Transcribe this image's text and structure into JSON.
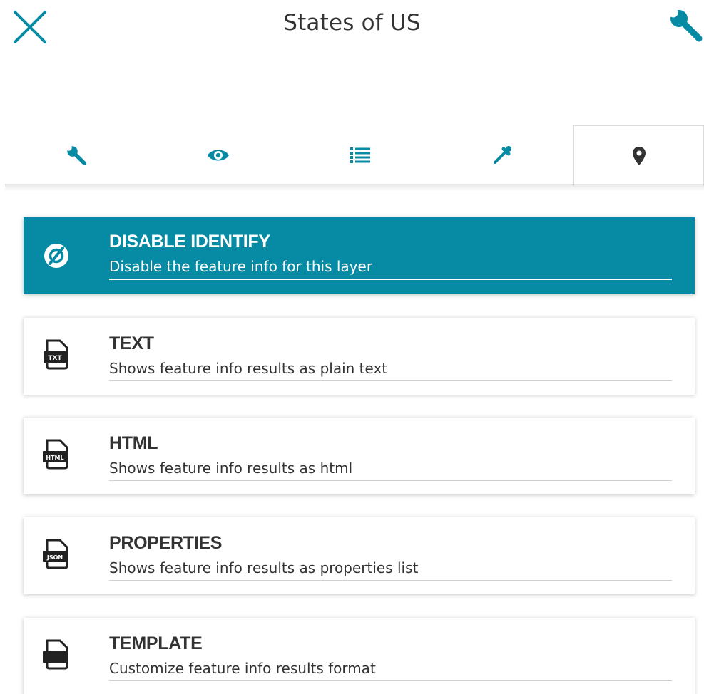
{
  "header": {
    "title": "States of US",
    "close_icon": "close-icon",
    "settings_icon": "wrench-icon"
  },
  "tabs": [
    {
      "icon": "wrench-icon",
      "active": false
    },
    {
      "icon": "eye-icon",
      "active": false
    },
    {
      "icon": "list-icon",
      "active": false
    },
    {
      "icon": "eyedropper-icon",
      "active": false
    },
    {
      "icon": "map-marker-icon",
      "active": true
    }
  ],
  "colors": {
    "accent": "#078aa3",
    "text": "#333333",
    "tab_icon": "#078aa3"
  },
  "options": [
    {
      "title": "DISABLE IDENTIFY",
      "description": "Disable the feature info for this layer",
      "icon": "disable-icon",
      "selected": true
    },
    {
      "title": "TEXT",
      "description": "Shows feature info results as plain text",
      "icon": "txt-file-icon",
      "badge": "TXT",
      "selected": false
    },
    {
      "title": "HTML",
      "description": "Shows feature info results as html",
      "icon": "html-file-icon",
      "badge": "HTML",
      "selected": false
    },
    {
      "title": "PROPERTIES",
      "description": "Shows feature info results as properties list",
      "icon": "json-file-icon",
      "badge": "JSON",
      "selected": false
    },
    {
      "title": "TEMPLATE",
      "description": "Customize feature info results format",
      "icon": "template-file-icon",
      "selected": false
    }
  ]
}
